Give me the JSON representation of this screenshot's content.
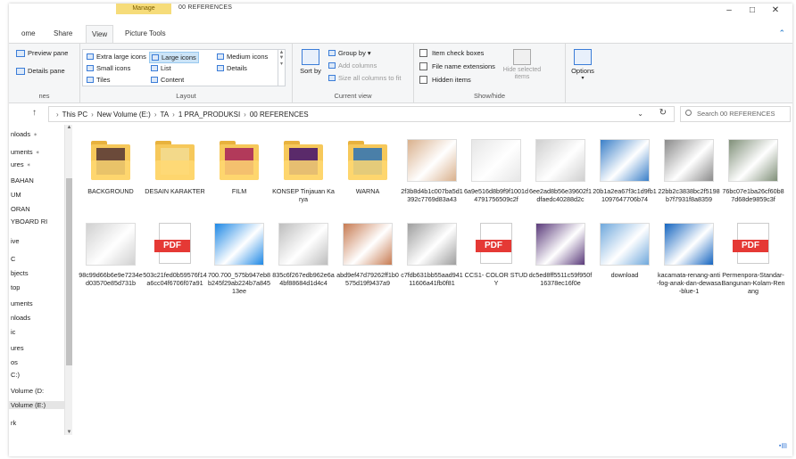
{
  "title": {
    "manage_tab": "Manage",
    "text": "00 REFERENCES"
  },
  "window_controls": {
    "minimize": "–",
    "maximize": "□",
    "close": "✕"
  },
  "tabs": [
    {
      "label": "ome"
    },
    {
      "label": "Share"
    },
    {
      "label": "View"
    },
    {
      "label": "Picture Tools"
    }
  ],
  "ribbon": {
    "panes": {
      "preview_pane": "Preview pane",
      "details_pane": "Details pane",
      "label": "nes"
    },
    "layout": {
      "extra_large": "Extra large icons",
      "large": "Large icons",
      "medium": "Medium icons",
      "small": "Small icons",
      "list": "List",
      "details": "Details",
      "tiles": "Tiles",
      "content": "Content",
      "label": "Layout"
    },
    "current_view": {
      "sort_by": "Sort by",
      "group_by": "Group by",
      "add_columns": "Add columns",
      "size_all": "Size all columns to fit",
      "label": "Current view"
    },
    "show_hide": {
      "item_check": "Item check boxes",
      "file_ext": "File name extensions",
      "hidden_items": "Hidden items",
      "hide_selected": "Hide selected items",
      "options": "Options",
      "label": "Show/hide"
    }
  },
  "address": {
    "crumbs": [
      "This PC",
      "New Volume (E:)",
      "TA",
      "1 PRA_PRODUKSI",
      "00 REFERENCES"
    ],
    "search_placeholder": "Search 00 REFERENCES"
  },
  "nav_items": [
    {
      "label": "nloads",
      "pinned": true
    },
    {
      "label": "uments",
      "pinned": true
    },
    {
      "label": "ures",
      "pinned": true
    },
    {
      "label": "BAHAN",
      "pinned": false
    },
    {
      "label": "UM",
      "pinned": false
    },
    {
      "label": "ORAN",
      "pinned": false
    },
    {
      "label": "YBOARD RI",
      "pinned": false
    },
    {
      "label": "ive",
      "pinned": false
    },
    {
      "label": "C",
      "pinned": false
    },
    {
      "label": "bjects",
      "pinned": false
    },
    {
      "label": "top",
      "pinned": false
    },
    {
      "label": "uments",
      "pinned": false
    },
    {
      "label": "nloads",
      "pinned": false
    },
    {
      "label": "ic",
      "pinned": false
    },
    {
      "label": "ures",
      "pinned": false
    },
    {
      "label": "os",
      "pinned": false
    },
    {
      "label": "C:)",
      "pinned": false
    },
    {
      "label": "Volume (D:",
      "pinned": false
    },
    {
      "label": "Volume (E:)",
      "pinned": false
    },
    {
      "label": "rk",
      "pinned": false
    }
  ],
  "files": [
    {
      "name": "BACKGROUND",
      "kind": "folder",
      "accent": "#6b4a3a"
    },
    {
      "name": "DESAIN KARAKTER",
      "kind": "folder",
      "accent": "#f3d98a"
    },
    {
      "name": "FILM",
      "kind": "folder",
      "accent": "#b23a5a"
    },
    {
      "name": "KONSEP Tinjauan Karya",
      "kind": "folder",
      "accent": "#5a2a6a"
    },
    {
      "name": "WARNA",
      "kind": "folder",
      "accent": "#4a7fa8"
    },
    {
      "name": "2f3b8d4b1c007ba5d1392c7769d83a43",
      "kind": "image",
      "accent": "#d9b08c"
    },
    {
      "name": "6a9e516d8b9f9f1001d4791756509c2f",
      "kind": "image",
      "accent": "#e6e6e6"
    },
    {
      "name": "6ee2ad8b56e39602f1dfaedc40288d2c",
      "kind": "image",
      "accent": "#cfcfcf"
    },
    {
      "name": "20b1a2ea67f3c1d9fb11097647706b74",
      "kind": "image",
      "accent": "#3a7fc8"
    },
    {
      "name": "22bb2c3838bc2f5198b7f7931f8a8359",
      "kind": "image",
      "accent": "#8a8a8a"
    },
    {
      "name": "76bc07e1ba26cf60b87d68de9859c3f",
      "kind": "image",
      "accent": "#7f8f78"
    },
    {
      "name": "98c99d66b6e9e7234ed03570e85d731b",
      "kind": "image",
      "accent": "#d0d0d0"
    },
    {
      "name": "503c21fed0b59576f14a6cc04f6706f07a91",
      "kind": "pdf",
      "accent": "#e53935"
    },
    {
      "name": "700.700_575b947eb8b245f29ab224b7a84513ee",
      "kind": "image",
      "accent": "#1e88e5"
    },
    {
      "name": "835c6f267edb962e6a4bf88684d1d4c4",
      "kind": "image",
      "accent": "#bdbdbd"
    },
    {
      "name": "abd9ef47d79262ff1b0575d19f9437a9",
      "kind": "image",
      "accent": "#c77b52"
    },
    {
      "name": "c7fdb631bb55aad94111606a41fb0f81",
      "kind": "image",
      "accent": "#9e9e9e"
    },
    {
      "name": "CCS1- COLOR STUDY",
      "kind": "pdf",
      "accent": "#e53935"
    },
    {
      "name": "dc5ed8ff5511c59f950f16378ec16f0e",
      "kind": "image",
      "accent": "#5a3a7a"
    },
    {
      "name": "download",
      "kind": "image",
      "accent": "#6fa8dc"
    },
    {
      "name": "kacamata-renang-anti-fog-anak-dan-dewasa-blue-1",
      "kind": "image",
      "accent": "#1565c0"
    },
    {
      "name": "Permenpora-Standar-Bangunan-Kolam-Renang",
      "kind": "pdf",
      "accent": "#e53935"
    }
  ],
  "pdf_label": "PDF"
}
